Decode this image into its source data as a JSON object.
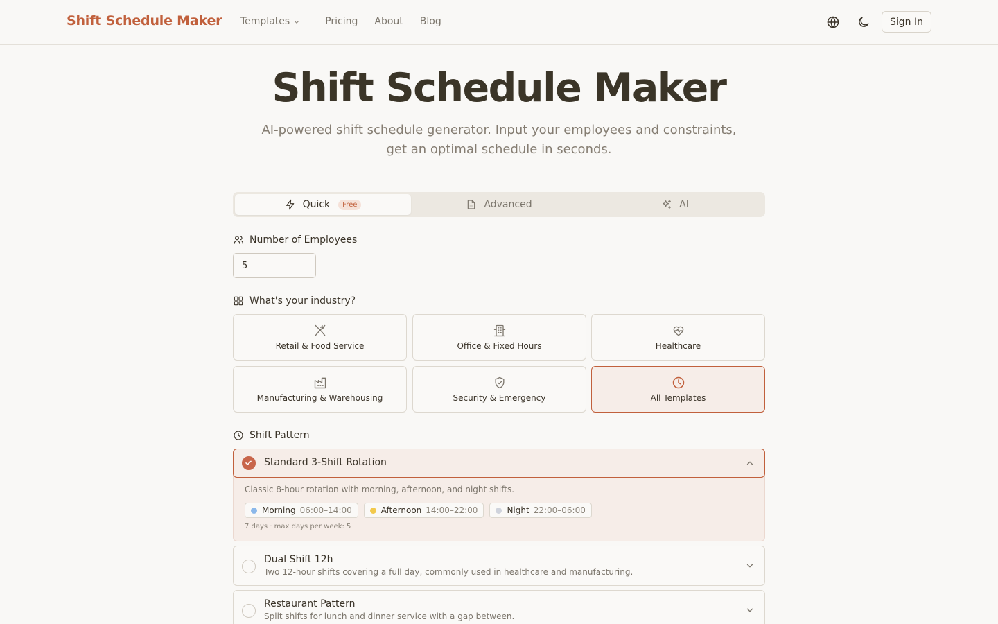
{
  "header": {
    "brand": "Shift Schedule Maker",
    "nav": {
      "templates": "Templates",
      "pricing": "Pricing",
      "about": "About",
      "blog": "Blog"
    },
    "sign_in": "Sign In"
  },
  "hero": {
    "title": "Shift Schedule Maker",
    "subtitle_line1": "AI-powered shift schedule generator. Input your employees and constraints,",
    "subtitle_line2": "get an optimal schedule in seconds."
  },
  "tabs": [
    {
      "label": "Quick",
      "badge": "Free",
      "active": true
    },
    {
      "label": "Advanced",
      "active": false
    },
    {
      "label": "AI",
      "active": false
    }
  ],
  "employees": {
    "label": "Number of Employees",
    "value": "5"
  },
  "industry": {
    "label": "What's your industry?",
    "options": [
      {
        "label": "Retail & Food Service",
        "icon": "utensils-icon"
      },
      {
        "label": "Office & Fixed Hours",
        "icon": "building-icon"
      },
      {
        "label": "Healthcare",
        "icon": "heart-pulse-icon"
      },
      {
        "label": "Manufacturing & Warehousing",
        "icon": "factory-icon"
      },
      {
        "label": "Security & Emergency",
        "icon": "shield-check-icon"
      },
      {
        "label": "All Templates",
        "icon": "clock-icon",
        "selected": true
      }
    ]
  },
  "shift_pattern": {
    "label": "Shift Pattern",
    "selected": {
      "title": "Standard 3-Shift Rotation",
      "description": "Classic 8-hour rotation with morning, afternoon, and night shifts.",
      "shifts": [
        {
          "name": "Morning",
          "time": "06:00–14:00",
          "color": "#8bb8ea"
        },
        {
          "name": "Afternoon",
          "time": "14:00–22:00",
          "color": "#f2c94c"
        },
        {
          "name": "Night",
          "time": "22:00–06:00",
          "color": "#cfd3dc"
        }
      ],
      "meta": "7 days · max days per week: 5"
    },
    "others": [
      {
        "title": "Dual Shift 12h",
        "description": "Two 12-hour shifts covering a full day, commonly used in healthcare and manufacturing."
      },
      {
        "title": "Restaurant Pattern",
        "description": "Split shifts for lunch and dinner service with a gap between."
      }
    ]
  },
  "colors": {
    "accent": "#c1603c",
    "background": "#f9f8f6",
    "selected_bg": "#f6ede8"
  }
}
